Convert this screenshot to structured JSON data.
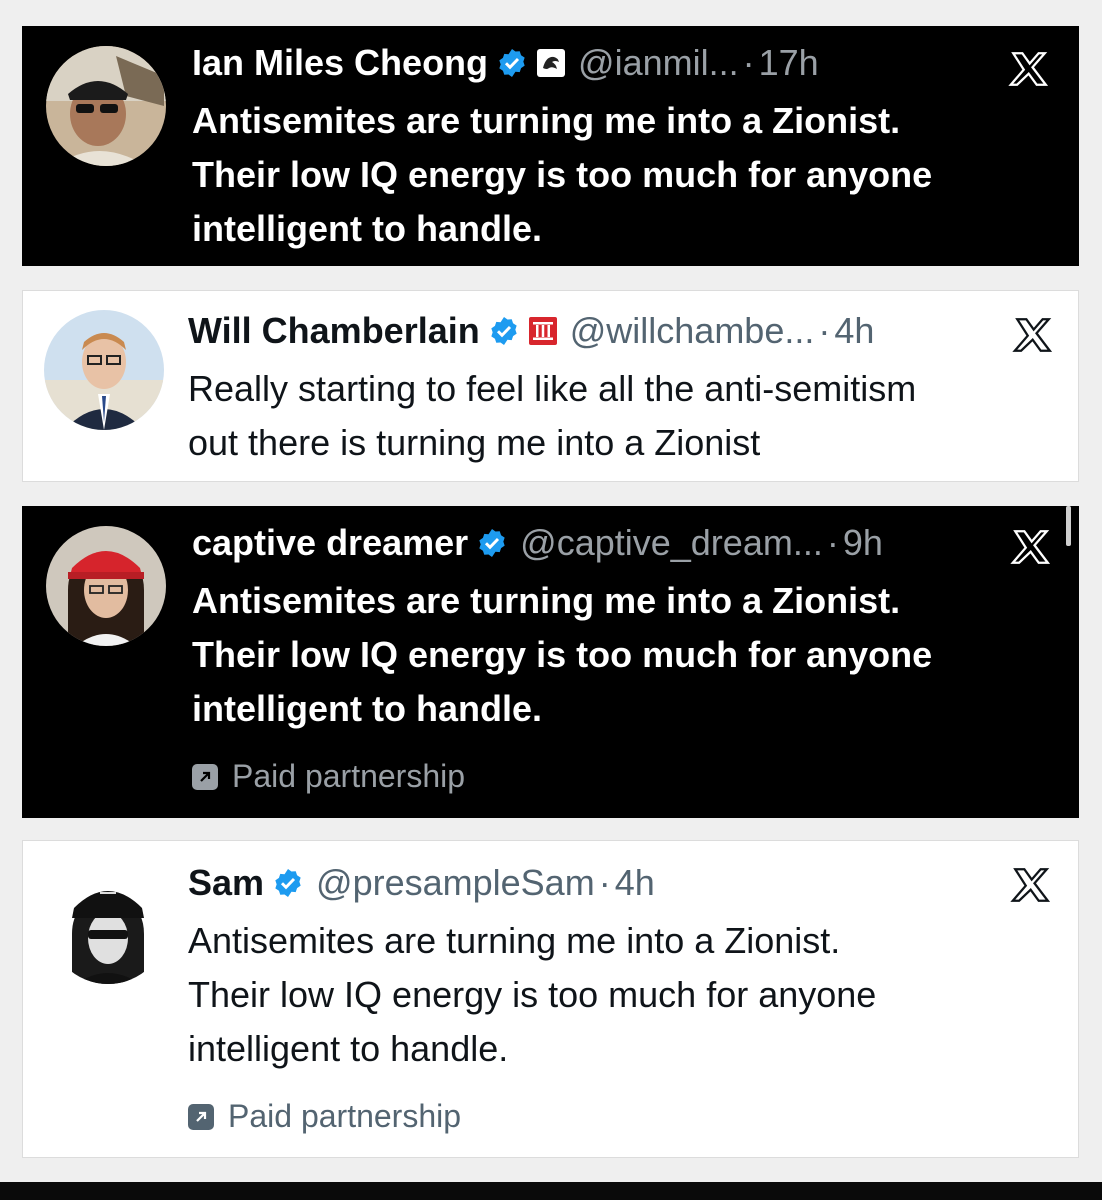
{
  "colors": {
    "dark_bg": "#000000",
    "light_bg": "#ffffff",
    "verified_blue": "#1d9bf0",
    "muted_dark": "#9aa0a6",
    "muted_light": "#536471"
  },
  "tweets": [
    {
      "theme": "dark",
      "name": "Ian Miles Cheong",
      "affiliation_icon": "dragon-badge-icon",
      "handle": "@ianmil...",
      "separator": "·",
      "time": "17h",
      "lines": [
        "Antisemites are turning me into a Zionist.",
        "Their low IQ energy is too much for anyone",
        "intelligent to handle."
      ]
    },
    {
      "theme": "light",
      "name": "Will Chamberlain",
      "affiliation_icon": "roman-three-badge-icon",
      "handle": "@willchambe...",
      "separator": "·",
      "time": "4h",
      "lines": [
        "Really starting to feel like all the anti-semitism",
        "out there is turning me into a Zionist"
      ]
    },
    {
      "theme": "dark",
      "name": "captive dreamer",
      "handle": "@captive_dream...",
      "separator": "·",
      "time": "9h",
      "lines": [
        "Antisemites are turning me into a Zionist.",
        "Their low IQ energy is too much for anyone",
        "intelligent to handle."
      ],
      "paid_label": "Paid partnership"
    },
    {
      "theme": "light",
      "name": "Sam",
      "handle": "@presampleSam",
      "separator": "·",
      "time": "4h",
      "lines": [
        "Antisemites are turning me into a Zionist.",
        "Their low IQ energy is too much for anyone",
        "intelligent to handle."
      ],
      "paid_label": "Paid partnership"
    }
  ]
}
